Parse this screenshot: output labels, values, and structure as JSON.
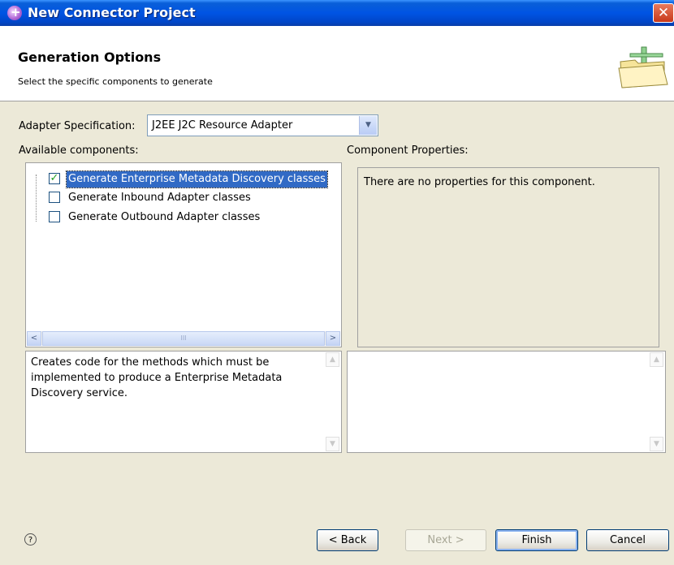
{
  "window": {
    "title": "New Connector Project",
    "close_glyph": "✕"
  },
  "banner": {
    "title": "Generation Options",
    "description": "Select the specific components to generate",
    "icon": "wizard-folder-icon"
  },
  "adapter": {
    "label": "Adapter Specification:",
    "value": "J2EE J2C Resource Adapter"
  },
  "components": {
    "label": "Available components:",
    "items": [
      {
        "label": "Generate Enterprise Metadata Discovery classes",
        "checked": true,
        "selected": true
      },
      {
        "label": "Generate Inbound Adapter classes",
        "checked": false,
        "selected": false
      },
      {
        "label": "Generate Outbound Adapter classes",
        "checked": false,
        "selected": false
      }
    ],
    "scroll": {
      "left": "<",
      "right": ">",
      "thumb": "III"
    }
  },
  "properties": {
    "label": "Component Properties:",
    "message": "There are no properties for this component."
  },
  "description": "Creates code for the methods which must be implemented to produce a Enterprise Metadata Discovery service.",
  "buttons": {
    "help": "?",
    "back": "< Back",
    "next": "Next >",
    "finish": "Finish",
    "cancel": "Cancel"
  }
}
